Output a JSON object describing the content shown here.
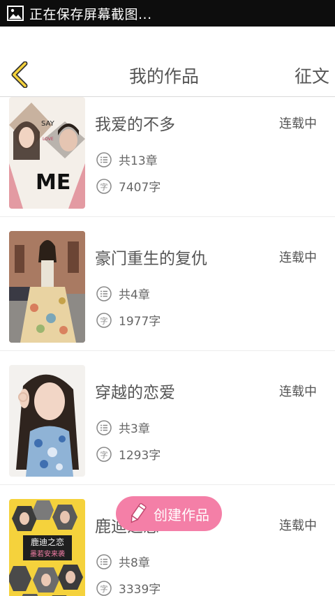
{
  "statusbar": {
    "icon": "image-icon",
    "text": "正在保存屏幕截图..."
  },
  "header": {
    "title": "我的作品",
    "action": "征文",
    "back_icon": "chevron-left-icon",
    "accent": "#f5d23c"
  },
  "works": [
    {
      "title": "我爱的不多",
      "status": "连载中",
      "chapters": "共13章",
      "words": "7407字",
      "cover_text": [
        "SAY",
        "LOVE",
        "ME"
      ]
    },
    {
      "title": "豪门重生的复仇",
      "status": "连载中",
      "chapters": "共4章",
      "words": "1977字"
    },
    {
      "title": "穿越的恋爱",
      "status": "连载中",
      "chapters": "共3章",
      "words": "1293字"
    },
    {
      "title": "鹿迪之恋",
      "status": "连载中",
      "chapters": "共8章",
      "words": "3339字",
      "cover_text": [
        "鹿迪之恋",
        "墨若安来袭"
      ]
    }
  ],
  "fab": {
    "label": "创建作品",
    "color": "#f47fa7",
    "icon": "pencil-icon"
  },
  "icons": {
    "chapters": "list-icon",
    "words": "word-count-icon"
  }
}
